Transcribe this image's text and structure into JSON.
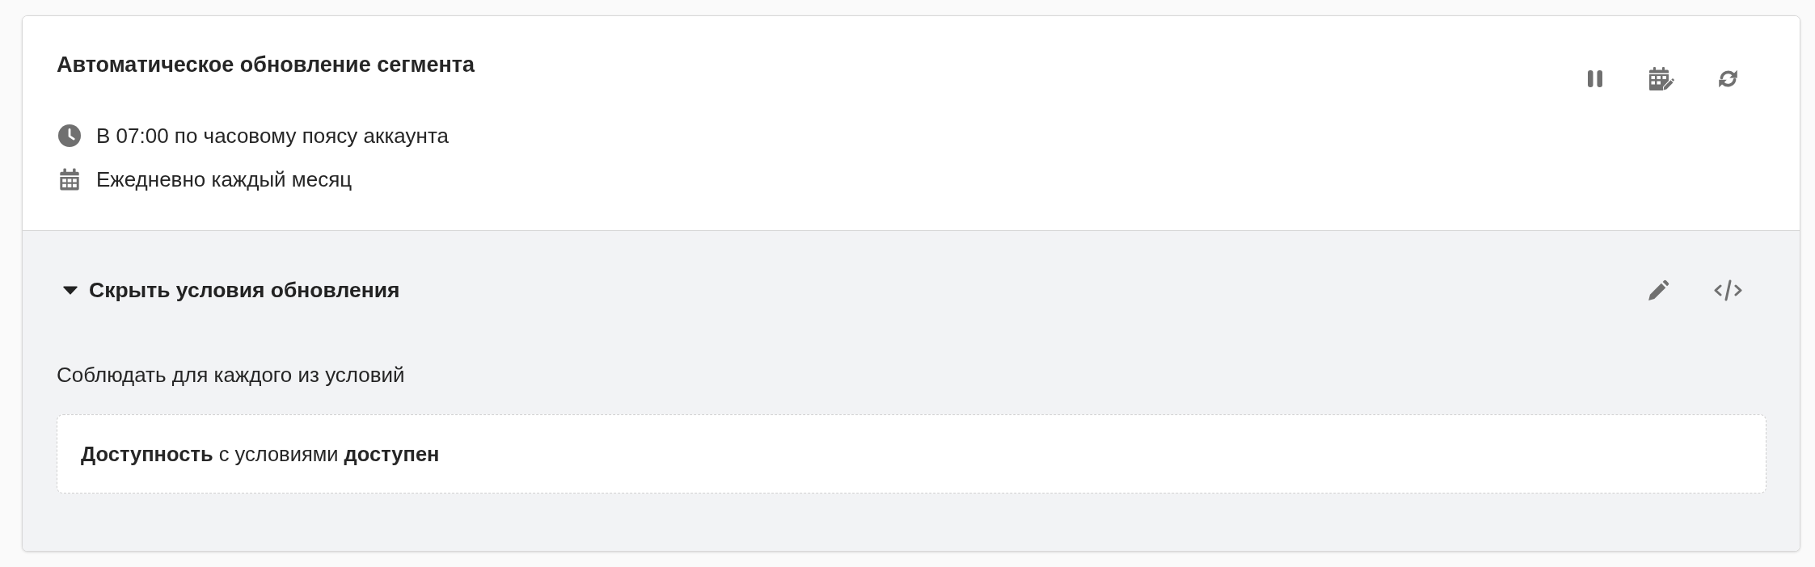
{
  "auto_update": {
    "title": "Автоматическое обновление сегмента",
    "schedule": [
      {
        "kind": "time",
        "text": "В 07:00 по часовому поясу аккаунта"
      },
      {
        "kind": "date",
        "text": "Ежедневно каждый месяц"
      }
    ]
  },
  "update_conditions": {
    "toggle_label": "Скрыть условия обновления",
    "expanded": true,
    "rule_mode": "Соблюдать для каждого из условий",
    "conditions": [
      "**Доступность** с условиями **доступен**"
    ]
  }
}
